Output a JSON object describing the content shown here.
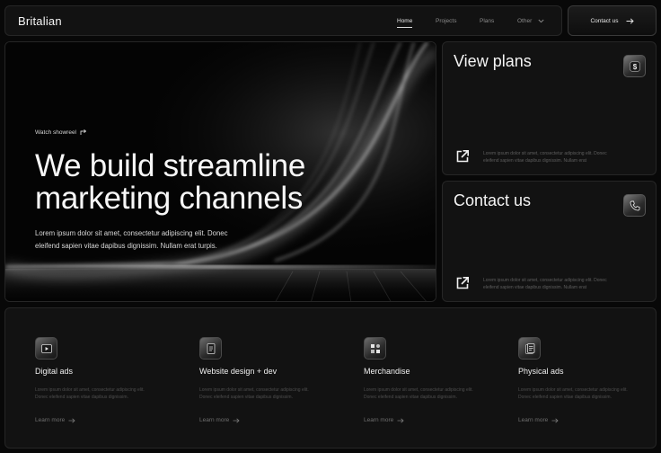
{
  "nav": {
    "brand": "Britalian",
    "links": [
      {
        "label": "Home",
        "active": true
      },
      {
        "label": "Projects",
        "active": false
      },
      {
        "label": "Plans",
        "active": false
      },
      {
        "label": "Other",
        "active": false
      }
    ],
    "contact_label": "Contact us"
  },
  "hero": {
    "watch_label": "Watch showreel",
    "title_line1": "We build streamline",
    "title_line2": "marketing channels",
    "desc_line1": "Lorem ipsum dolor sit amet, consectetur adipiscing elit. Donec",
    "desc_line2": "eleifend sapien vitae dapibus dignissim. Nullam erat turpis."
  },
  "plans_card": {
    "title": "View plans",
    "text_line1": "Lorem ipsum dolor sit amet, consectetur adipiscing elit. Donec",
    "text_line2": "eleifend sapien vitae dapibus dignissim. Nullam erat"
  },
  "contact_card": {
    "title": "Contact us",
    "text_line1": "Lorem ipsum dolor sit amet, consectetur adipiscing elit. Donec",
    "text_line2": "eleifend sapien vitae dapibus dignissim. Nullam erat"
  },
  "services": [
    {
      "title": "Digital ads",
      "icon": "play-icon",
      "desc_line1": "Lorem ipsum dolor sit amet, consectetur adipiscing elit.",
      "desc_line2": "Donec eleifend sapien vitae dapibus dignissim.",
      "link": "Learn more"
    },
    {
      "title": "Website design + dev",
      "icon": "code-file-icon",
      "desc_line1": "Lorem ipsum dolor sit amet, consectetur adipiscing elit.",
      "desc_line2": "Donec eleifend sapien vitae dapibus dignissim.",
      "link": "Learn more"
    },
    {
      "title": "Merchandise",
      "icon": "shapes-icon",
      "desc_line1": "Lorem ipsum dolor sit amet, consectetur adipiscing elit.",
      "desc_line2": "Donec eleifend sapien vitae dapibus dignissim.",
      "link": "Learn more"
    },
    {
      "title": "Physical ads",
      "icon": "document-icon",
      "desc_line1": "Lorem ipsum dolor sit amet, consectetur adipiscing elit.",
      "desc_line2": "Donec eleifend sapien vitae dapibus dignissim.",
      "link": "Learn more"
    }
  ]
}
